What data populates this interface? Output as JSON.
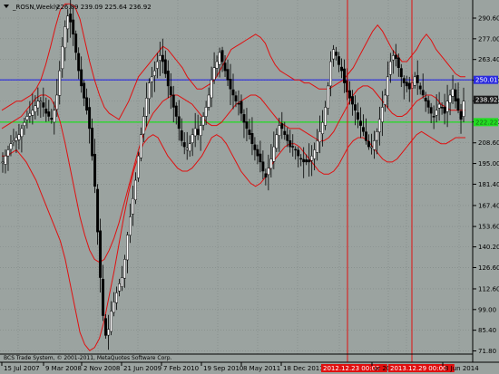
{
  "header": {
    "symbol": "_ROSN,Weekly",
    "ohlc": "226.89 239.09 225.64 236.92"
  },
  "copyright": "BCS Trade System, © 2001-2011, MetaQuotes Software Corp.",
  "colors": {
    "background": "#9ba3a0",
    "grid": "#7f8784",
    "candle": "#000000",
    "envelope": "#e01010",
    "line_upper": "#2a2ae0",
    "line_lower": "#22dd22",
    "vline": "#e01010",
    "price_tag": "#1a1a1a"
  },
  "chart_data": {
    "type": "candlestick",
    "y_ticks": [
      290.6,
      277.0,
      263.4,
      249.8,
      236.2,
      222.4,
      208.6,
      195.0,
      181.4,
      167.4,
      153.6,
      140.2,
      126.6,
      112.6,
      99.0,
      85.4,
      71.8
    ],
    "y_range": [
      71.8,
      300.0
    ],
    "x_labels": [
      "15 Jul 2007",
      "9 Mar 2008",
      "2 Nov 2008",
      "21 Jun 2009",
      "7 Feb 2010",
      "19 Sep 2010",
      "8 May 2011",
      "18 Dec 2011",
      "2012.12.23 00:00",
      "ar 20",
      "2013.12.29 00:00",
      "8 Jun 2014"
    ],
    "hlines": [
      {
        "name": "upper-level",
        "value": 250.01,
        "label": "250.01"
      },
      {
        "name": "lower-level",
        "value": 222.22,
        "label": "222.22"
      }
    ],
    "current_price": {
      "value": 236.92,
      "label": "238.92"
    },
    "vertical_markers": [
      "2012.12.23 00:00",
      "2013.12.29 00:00"
    ],
    "close_series": [
      196,
      200,
      204,
      208,
      210,
      212,
      214,
      218,
      222,
      226,
      228,
      230,
      233,
      236,
      236,
      232,
      228,
      226,
      224,
      230,
      240,
      256,
      272,
      285,
      292,
      288,
      280,
      268,
      256,
      246,
      238,
      230,
      218,
      200,
      180,
      150,
      120,
      95,
      82,
      86,
      98,
      104,
      110,
      116,
      120,
      132,
      148,
      160,
      172,
      184,
      200,
      214,
      226,
      238,
      248,
      252,
      256,
      262,
      266,
      262,
      254,
      246,
      240,
      232,
      226,
      218,
      210,
      206,
      205,
      208,
      214,
      218,
      214,
      220,
      226,
      232,
      240,
      250,
      258,
      262,
      268,
      262,
      256,
      250,
      244,
      240,
      236,
      234,
      228,
      222,
      218,
      214,
      208,
      204,
      200,
      196,
      190,
      186,
      192,
      198,
      206,
      214,
      220,
      218,
      214,
      210,
      206,
      206,
      204,
      200,
      198,
      196,
      196,
      196,
      200,
      204,
      210,
      216,
      222,
      232,
      246,
      262,
      270,
      266,
      260,
      256,
      248,
      242,
      238,
      234,
      230,
      224,
      220,
      216,
      210,
      206,
      206,
      210,
      216,
      224,
      232,
      240,
      252,
      262,
      266,
      264,
      258,
      252,
      248,
      246,
      244,
      248,
      252,
      248,
      244,
      240,
      236,
      232,
      228,
      226,
      230,
      234,
      232,
      228,
      236,
      240,
      244,
      236,
      230,
      224,
      236
    ],
    "upper_band": [
      230,
      232,
      234,
      236,
      236,
      238,
      240,
      244,
      250,
      260,
      272,
      285,
      296,
      300,
      300,
      298,
      290,
      276,
      262,
      250,
      240,
      232,
      228,
      226,
      224,
      230,
      236,
      244,
      252,
      256,
      260,
      264,
      268,
      272,
      270,
      266,
      262,
      258,
      252,
      248,
      244,
      244,
      246,
      248,
      252,
      258,
      264,
      270,
      272,
      274,
      276,
      278,
      280,
      278,
      274,
      266,
      260,
      256,
      254,
      252,
      250,
      250,
      248,
      248,
      246,
      244,
      244,
      244,
      246,
      248,
      250,
      254,
      258,
      264,
      270,
      276,
      282,
      286,
      282,
      276,
      270,
      266,
      262,
      262,
      266,
      270,
      276,
      280,
      276,
      270,
      266,
      262,
      258,
      254,
      252,
      252
    ],
    "lower_band": [
      200,
      200,
      202,
      204,
      200,
      196,
      190,
      184,
      176,
      168,
      160,
      152,
      144,
      132,
      116,
      100,
      84,
      76,
      72,
      74,
      80,
      92,
      108,
      124,
      142,
      160,
      176,
      190,
      200,
      208,
      212,
      214,
      212,
      206,
      200,
      196,
      192,
      190,
      190,
      192,
      196,
      200,
      206,
      212,
      214,
      212,
      208,
      202,
      196,
      190,
      186,
      182,
      180,
      182,
      186,
      192,
      198,
      202,
      206,
      208,
      208,
      206,
      202,
      198,
      194,
      190,
      188,
      188,
      190,
      194,
      200,
      206,
      210,
      212,
      212,
      210,
      206,
      202,
      198,
      196,
      196,
      198,
      202,
      206,
      210,
      214,
      216,
      214,
      212,
      210,
      208,
      208,
      210,
      212,
      212,
      212
    ],
    "mid_band": [
      218,
      220,
      222,
      224,
      226,
      230,
      234,
      238,
      240,
      240,
      238,
      232,
      222,
      208,
      192,
      176,
      160,
      148,
      138,
      132,
      130,
      132,
      138,
      146,
      156,
      168,
      180,
      192,
      204,
      214,
      222,
      228,
      232,
      236,
      238,
      240,
      240,
      238,
      236,
      234,
      230,
      226,
      222,
      220,
      220,
      222,
      226,
      230,
      234,
      236,
      238,
      240,
      240,
      238,
      234,
      230,
      226,
      222,
      220,
      218,
      218,
      218,
      216,
      214,
      212,
      210,
      210,
      212,
      216,
      222,
      228,
      234,
      240,
      244,
      246,
      246,
      244,
      240,
      236,
      232,
      228,
      226,
      226,
      228,
      232,
      236,
      238,
      240,
      240,
      238,
      234,
      232,
      230,
      230,
      230,
      230
    ]
  }
}
